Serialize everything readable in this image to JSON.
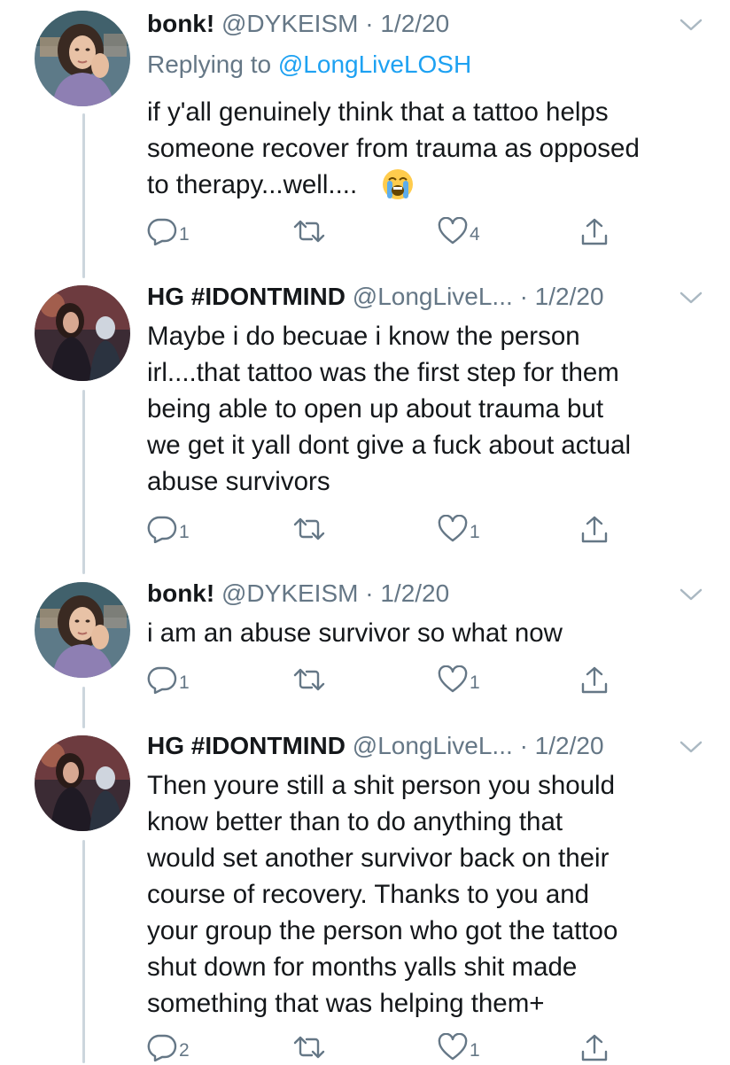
{
  "tweets": [
    {
      "name": "bonk!",
      "handle": "@DYKEISM",
      "dot": "·",
      "date": "1/2/20",
      "reply_prefix": "Replying to",
      "reply_handle": "@LongLiveLOSH",
      "lines": [
        "if y'all genuinely think that a tattoo helps",
        "someone recover from trauma as opposed",
        "to therapy...well...."
      ],
      "emoji": "loudly-crying-face-emoji",
      "reply_count": "1",
      "retweet_count": "",
      "like_count": "4"
    },
    {
      "name": "HG #IDONTMIND",
      "handle": "@LongLiveL...",
      "dot": "·",
      "date": "1/2/20",
      "lines": [
        "Maybe i do becuae i know the person",
        "irl....that tattoo was the first step for them",
        "being able to open up about trauma but",
        "we get it yall dont give a fuck about actual",
        "abuse survivors"
      ],
      "reply_count": "1",
      "retweet_count": "",
      "like_count": "1"
    },
    {
      "name": "bonk!",
      "handle": "@DYKEISM",
      "dot": "·",
      "date": "1/2/20",
      "lines": [
        "i am an abuse survivor so what now"
      ],
      "reply_count": "1",
      "retweet_count": "",
      "like_count": "1"
    },
    {
      "name": "HG #IDONTMIND",
      "handle": "@LongLiveL...",
      "dot": "·",
      "date": "1/2/20",
      "lines": [
        "Then youre still a shit person you should",
        "know better than to do anything that",
        "would set another survivor back on their",
        "course of recovery. Thanks to you and",
        "your group the person who got the tattoo",
        "shut down for months yalls shit made",
        "something that was helping them+"
      ],
      "reply_count": "2",
      "retweet_count": "",
      "like_count": "1"
    }
  ],
  "colors": {
    "text": "#14171a",
    "secondary": "#657786",
    "link": "#1da1f2",
    "thread_line": "#ccd6dd"
  },
  "icons": [
    "reply-icon",
    "retweet-icon",
    "like-icon",
    "share-icon",
    "chevron-down-icon"
  ]
}
